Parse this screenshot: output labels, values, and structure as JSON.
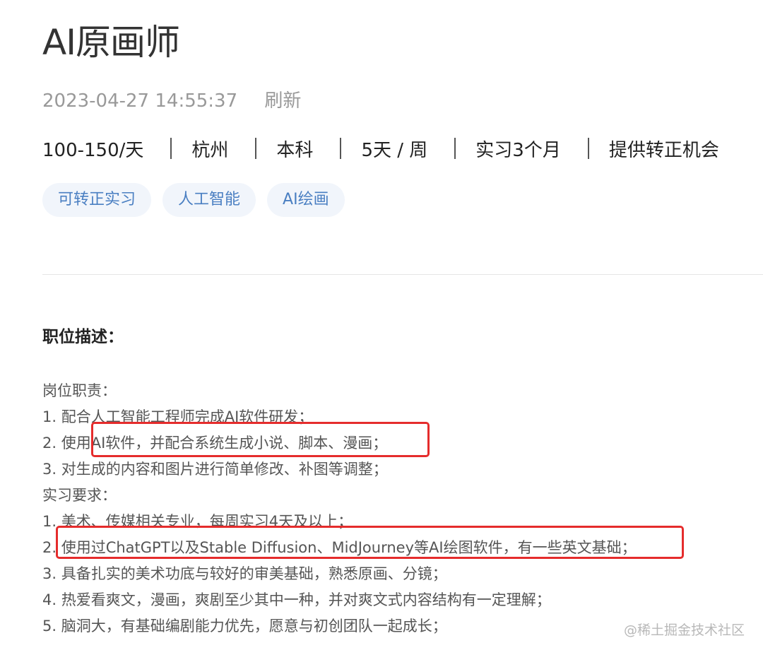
{
  "job": {
    "title": "AI原画师",
    "timestamp": "2023-04-27 14:55:37",
    "refresh_label": "刷新",
    "info": [
      "100-150/天",
      "杭州",
      "本科",
      "5天 / 周",
      "实习3个月",
      "提供转正机会"
    ],
    "tags": [
      "可转正实习",
      "人工智能",
      "AI绘画"
    ]
  },
  "description": {
    "heading": "职位描述：",
    "lines": [
      "岗位职责：",
      "1. 配合人工智能工程师完成AI软件研发；",
      "2. 使用AI软件，并配合系统生成小说、脚本、漫画；",
      "3. 对生成的内容和图片进行简单修改、补图等调整；",
      "实习要求：",
      "1. 美术、传媒相关专业，每周实习4天及以上；",
      "2. 使用过ChatGPT以及Stable Diffusion、MidJourney等AI绘图软件，有一些英文基础；",
      "3. 具备扎实的美术功底与较好的审美基础，熟悉原画、分镜；",
      "4. 热爱看爽文，漫画，爽剧至少其中一种，并对爽文式内容结构有一定理解；",
      "5. 脑洞大，有基础编剧能力优先，愿意与初创团队一起成长；"
    ]
  },
  "watermark": "@稀土掘金技术社区",
  "colors": {
    "tag_background": "#f1f5fb",
    "tag_text": "#4a7fc2",
    "highlight_border": "#e52c2c",
    "muted_text": "#999999"
  }
}
